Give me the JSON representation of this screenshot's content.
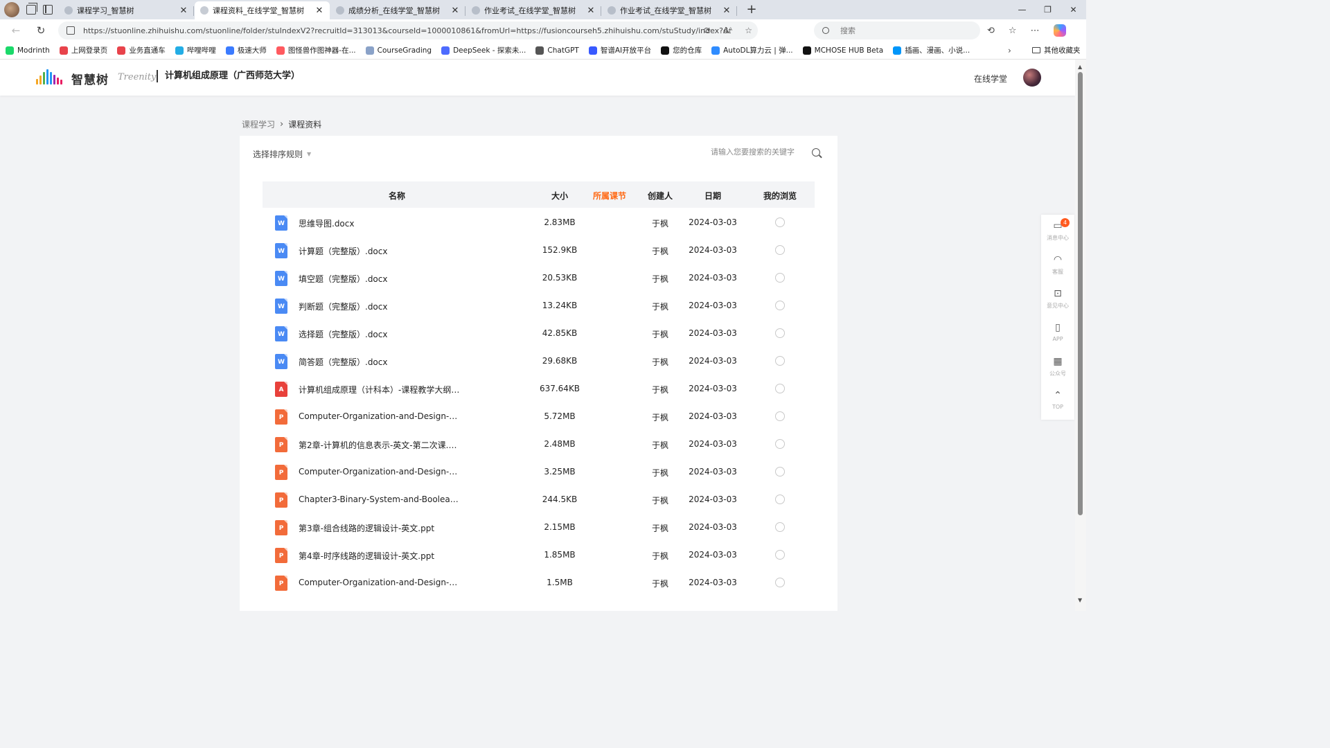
{
  "browser": {
    "tabs": [
      {
        "title": "课程学习_智慧树",
        "active": false
      },
      {
        "title": "课程资料_在线学堂_智慧树",
        "active": true
      },
      {
        "title": "成绩分析_在线学堂_智慧树",
        "active": false
      },
      {
        "title": "作业考试_在线学堂_智慧树",
        "active": false
      },
      {
        "title": "作业考试_在线学堂_智慧树",
        "active": false
      }
    ],
    "url": "https://stuonline.zhihuishu.com/stuonline/folder/stuIndexV2?recruitId=313013&courseId=1000010861&fromUrl=https://fusioncourseh5.zhihuishu.com/stuStudy/index?darkMode=1&s...",
    "search_placeholder": "搜索",
    "bookmarks": [
      {
        "label": "Modrinth",
        "color": "#1bd96a"
      },
      {
        "label": "上网登录页",
        "color": "#e8434b"
      },
      {
        "label": "业务直通车",
        "color": "#e8434b"
      },
      {
        "label": "哔哩哔哩",
        "color": "#23ade5"
      },
      {
        "label": "极速大师",
        "color": "#3b7bff"
      },
      {
        "label": "图怪兽作图神器-在...",
        "color": "#ff5a5f"
      },
      {
        "label": "CourseGrading",
        "color": "#8aa2c8"
      },
      {
        "label": "DeepSeek - 探索未...",
        "color": "#4d6bfe"
      },
      {
        "label": "ChatGPT",
        "color": "#555555"
      },
      {
        "label": "智谱AI开放平台",
        "color": "#3859ff"
      },
      {
        "label": "您的仓库",
        "color": "#111111"
      },
      {
        "label": "AutoDL算力云 | 弹...",
        "color": "#2f8cff"
      },
      {
        "label": "MCHOSE HUB Beta",
        "color": "#111111"
      },
      {
        "label": "插画、漫画、小说...",
        "color": "#0096fa"
      }
    ],
    "bookmarks_other": "其他收藏夹"
  },
  "header": {
    "logo_text": "智慧树",
    "logo_sub": "Treenity",
    "course_title": "计算机组成原理（广西师范大学）",
    "online_link": "在线学堂"
  },
  "breadcrumb": {
    "parent": "课程学习",
    "current": "课程资料"
  },
  "toolbar": {
    "sort_label": "选择排序规则",
    "search_placeholder": "请输入您要搜索的关键字"
  },
  "table": {
    "headers": {
      "name": "名称",
      "size": "大小",
      "chapter": "所属课节",
      "creator": "创建人",
      "date": "日期",
      "viewed": "我的浏览"
    },
    "rows": [
      {
        "type": "word",
        "name": "思维导图.docx",
        "size": "2.83MB",
        "creator": "于枫",
        "date": "2024-03-03"
      },
      {
        "type": "word",
        "name": "计算题（完整版）.docx",
        "size": "152.9KB",
        "creator": "于枫",
        "date": "2024-03-03"
      },
      {
        "type": "word",
        "name": "填空题（完整版）.docx",
        "size": "20.53KB",
        "creator": "于枫",
        "date": "2024-03-03"
      },
      {
        "type": "word",
        "name": "判断题（完整版）.docx",
        "size": "13.24KB",
        "creator": "于枫",
        "date": "2024-03-03"
      },
      {
        "type": "word",
        "name": "选择题（完整版）.docx",
        "size": "42.85KB",
        "creator": "于枫",
        "date": "2024-03-03"
      },
      {
        "type": "word",
        "name": "简答题（完整版）.docx",
        "size": "29.68KB",
        "creator": "于枫",
        "date": "2024-03-03"
      },
      {
        "type": "pdf",
        "name": "计算机组成原理（计科本）-课程教学大纲(2...",
        "size": "637.64KB",
        "creator": "于枫",
        "date": "2024-03-03"
      },
      {
        "type": "ppt",
        "name": "Computer-Organization-and-Design-proces...",
        "size": "5.72MB",
        "creator": "于枫",
        "date": "2024-03-03"
      },
      {
        "type": "ppt",
        "name": "第2章-计算机的信息表示-英文-第二次课.ppt",
        "size": "2.48MB",
        "creator": "于枫",
        "date": "2024-03-03"
      },
      {
        "type": "ppt",
        "name": "Computer-Organization-and-Design-memor...",
        "size": "3.25MB",
        "creator": "于枫",
        "date": "2024-03-03"
      },
      {
        "type": "ppt",
        "name": "Chapter3-Binary-System-and-Boolean-Alge...",
        "size": "244.5KB",
        "creator": "于枫",
        "date": "2024-03-03"
      },
      {
        "type": "ppt",
        "name": "第3章-组合线路的逻辑设计-英文.ppt",
        "size": "2.15MB",
        "creator": "于枫",
        "date": "2024-03-03"
      },
      {
        "type": "ppt",
        "name": "第4章-时序线路的逻辑设计-英文.ppt",
        "size": "1.85MB",
        "creator": "于枫",
        "date": "2024-03-03"
      },
      {
        "type": "ppt",
        "name": "Computer-Organization-and-Design-PPT2...",
        "size": "1.5MB",
        "creator": "于枫",
        "date": "2024-03-03"
      }
    ]
  },
  "file_icons": {
    "word": {
      "letter": "W",
      "color": "#4a8af4"
    },
    "pdf": {
      "letter": "A",
      "color": "#e8413b"
    },
    "ppt": {
      "letter": "P",
      "color": "#f26b3a"
    }
  },
  "side_tools": [
    {
      "icon": "message-icon",
      "glyph": "▭",
      "label": "消息中心",
      "badge": "4"
    },
    {
      "icon": "headset-icon",
      "glyph": "◠",
      "label": "客服",
      "badge": ""
    },
    {
      "icon": "feedback-icon",
      "glyph": "⊡",
      "label": "意见中心",
      "badge": ""
    },
    {
      "icon": "phone-icon",
      "glyph": "▯",
      "label": "APP",
      "badge": ""
    },
    {
      "icon": "qrcode-icon",
      "glyph": "▦",
      "label": "公众号",
      "badge": ""
    },
    {
      "icon": "top-icon",
      "glyph": "⌃",
      "label": "TOP",
      "badge": ""
    }
  ]
}
